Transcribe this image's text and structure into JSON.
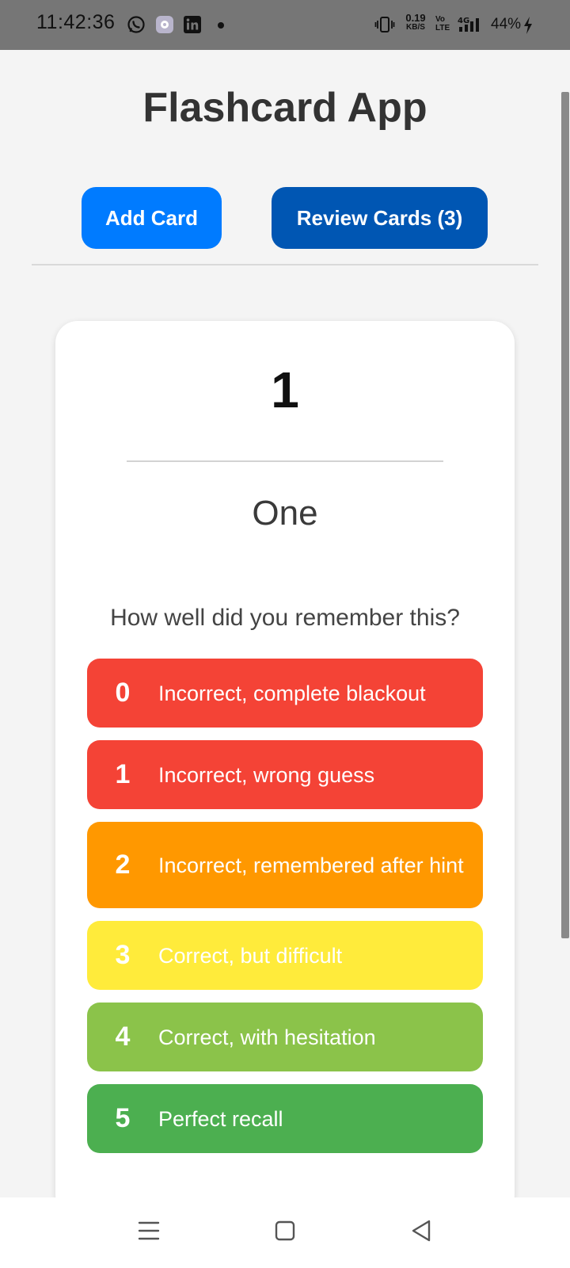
{
  "status_bar": {
    "time": "11:42:36",
    "net_speed_value": "0.19",
    "net_speed_unit": "KB/S",
    "volte_top": "Vo",
    "volte_bottom": "LTE",
    "network": "4G",
    "battery": "44%",
    "icons": [
      "whatsapp-icon",
      "settings-app-icon",
      "linkedin-icon",
      "notification-dot",
      "vibrate-icon",
      "signal-icon",
      "charging-icon"
    ]
  },
  "header": {
    "title": "Flashcard App",
    "add_card_label": "Add Card",
    "review_cards_label": "Review Cards (3)"
  },
  "card": {
    "front": "1",
    "back": "One",
    "rating_prompt": "How well did you remember this?",
    "ratings": [
      {
        "score": "0",
        "label": "Incorrect, complete blackout",
        "color": "#f44336"
      },
      {
        "score": "1",
        "label": "Incorrect, wrong guess",
        "color": "#f44336"
      },
      {
        "score": "2",
        "label": "Incorrect, remembered after hint",
        "color": "#ff9800"
      },
      {
        "score": "3",
        "label": "Correct, but difficult",
        "color": "#ffeb3b"
      },
      {
        "score": "4",
        "label": "Correct, with hesitation",
        "color": "#8bc34a"
      },
      {
        "score": "5",
        "label": "Perfect recall",
        "color": "#4caf50"
      }
    ]
  },
  "colors": {
    "primary": "#007bff",
    "primary_dark": "#0056b3",
    "background": "#f4f4f4"
  }
}
